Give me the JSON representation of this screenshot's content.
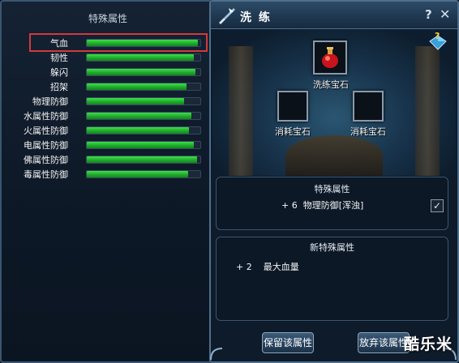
{
  "left_panel": {
    "title": "特殊属性",
    "attributes": [
      {
        "label": "气血",
        "fill": 0.98
      },
      {
        "label": "韧性",
        "fill": 0.94
      },
      {
        "label": "躲闪",
        "fill": 0.96
      },
      {
        "label": "招架",
        "fill": 0.88
      },
      {
        "label": "物理防御",
        "fill": 0.86
      },
      {
        "label": "水属性防御",
        "fill": 0.92
      },
      {
        "label": "火属性防御",
        "fill": 0.9
      },
      {
        "label": "电属性防御",
        "fill": 0.94
      },
      {
        "label": "佛属性防御",
        "fill": 0.97
      },
      {
        "label": "毒属性防御",
        "fill": 0.89
      }
    ],
    "highlight_color": "#d23a3a",
    "bar_color": "#2ec63a"
  },
  "right_panel": {
    "title": "洗 练",
    "help_label": "?",
    "close_label": "✕",
    "main_slot_label": "洗练宝石",
    "consume_slot_left_label": "消耗宝石",
    "consume_slot_right_label": "消耗宝石",
    "special_box": {
      "title": "特殊属性",
      "line": "+ 6  物理防御[浑浊]",
      "checked": true
    },
    "new_box": {
      "title": "新特殊属性",
      "line": "+ 2    最大血量"
    },
    "keep_button": "保留该属性",
    "discard_button": "放弃该属性"
  },
  "watermark": "酷乐米",
  "icons": [
    "sword-icon",
    "help-icon",
    "close-icon",
    "gem-help-icon",
    "red-potion-icon",
    "checkmark-icon"
  ]
}
